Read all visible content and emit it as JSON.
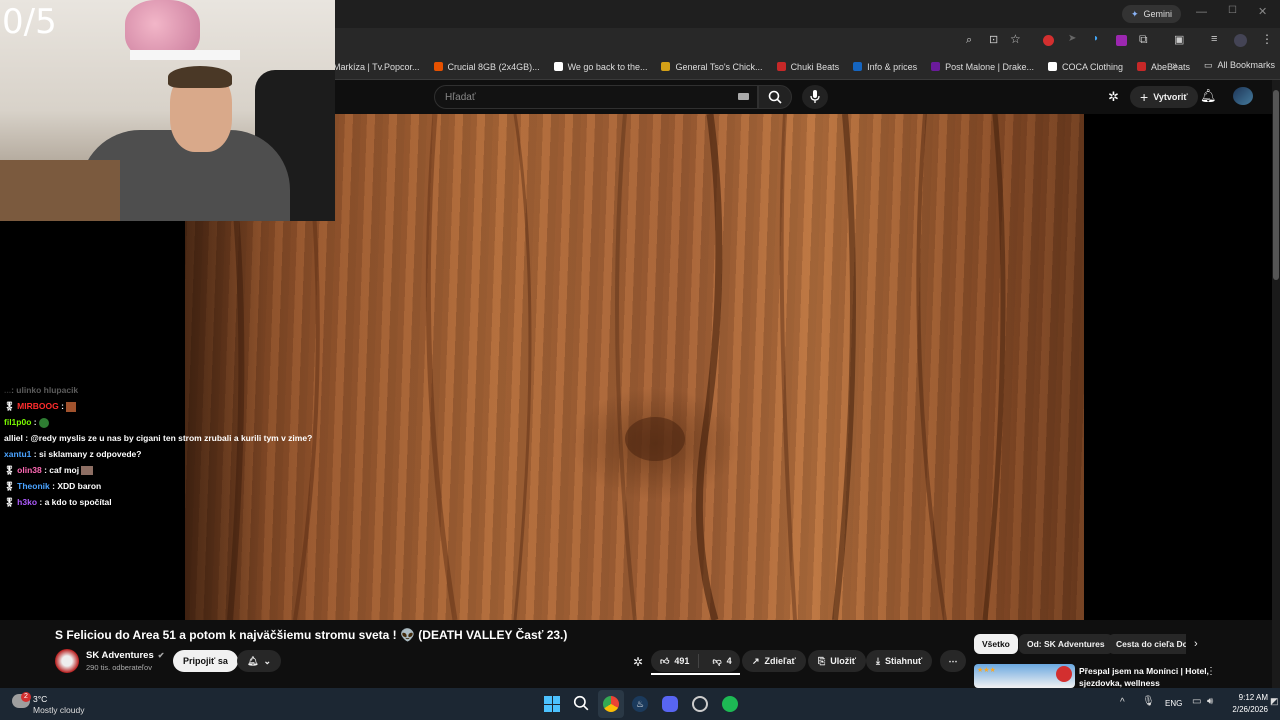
{
  "browser": {
    "gemini_label": "Gemini",
    "bookmarks": [
      {
        "label": "Markíza | Tv.Popcor...",
        "color": "#e65100"
      },
      {
        "label": "Crucial 8GB (2x4GB)...",
        "color": "#e65100"
      },
      {
        "label": "We go back to the...",
        "color": "#ffffff"
      },
      {
        "label": "General Tso's Chick...",
        "color": "#d4a017"
      },
      {
        "label": "Chuki Beats",
        "color": "#c62828"
      },
      {
        "label": "Info & prices",
        "color": "#1565c0"
      },
      {
        "label": "Post Malone | Drake...",
        "color": "#6a1b9a"
      },
      {
        "label": "COCA Clothing",
        "color": "#ffffff"
      },
      {
        "label": "AbeBeats",
        "color": "#c62828"
      }
    ],
    "all_bookmarks_label": "All Bookmarks"
  },
  "youtube": {
    "search_placeholder": "Hľadať",
    "create_label": "Vytvoriť",
    "video_title": "S Feliciou do Area 51 a potom k najväčšiemu stromu sveta ! 👽 (DEATH VALLEY Časť 23.)",
    "channel_name": "SK Adventures",
    "subscribers": "290 tis. odberateľov",
    "join_label": "Pripojiť sa",
    "likes": "491",
    "dislikes": "4",
    "share_label": "Zdieľať",
    "save_label": "Uložiť",
    "download_label": "Stiahnuť",
    "chips": [
      "Všetko",
      "Od: SK Adventures",
      "Cesta do cieľa Do"
    ],
    "rec_title_1": "Přespal jsem na Monínci | Hotel,",
    "rec_title_2": "sjezdovka, wellness"
  },
  "stream": {
    "counter": "0/5",
    "chat": [
      {
        "user": "...",
        "text": ": ulinko hlupacik",
        "user_color": "#888888",
        "badge": ""
      },
      {
        "user": "MIRBOOG",
        "text": ":",
        "user_color": "#ff2d2d",
        "badge": "🎖"
      },
      {
        "user": "fil1p0o",
        "text": ":",
        "user_color": "#7cfc00",
        "badge": ""
      },
      {
        "user": "alliel",
        "text": ": @redy myslis ze u nas by cigani ten strom zrubali a kurili tym v zime?",
        "user_color": "#ffffff",
        "badge": ""
      },
      {
        "user": "xantu1",
        "text": ": si sklamany z odpovede?",
        "user_color": "#4aa3ff",
        "badge": ""
      },
      {
        "user": "olin38",
        "text": ": caf moj",
        "user_color": "#ff69b4",
        "badge": "🎖"
      },
      {
        "user": "Theonik",
        "text": ": XDD baron",
        "user_color": "#4aa3ff",
        "badge": "🎖"
      },
      {
        "user": "h3ko",
        "text": ": a kdo to spočítal",
        "user_color": "#b05cff",
        "badge": "🎖"
      }
    ]
  },
  "taskbar": {
    "weather_temp": "3°C",
    "weather_desc": "Mostly cloudy",
    "weather_badge": "2",
    "lang": "ENG",
    "time": "9:12 AM",
    "date": "2/26/2026"
  }
}
